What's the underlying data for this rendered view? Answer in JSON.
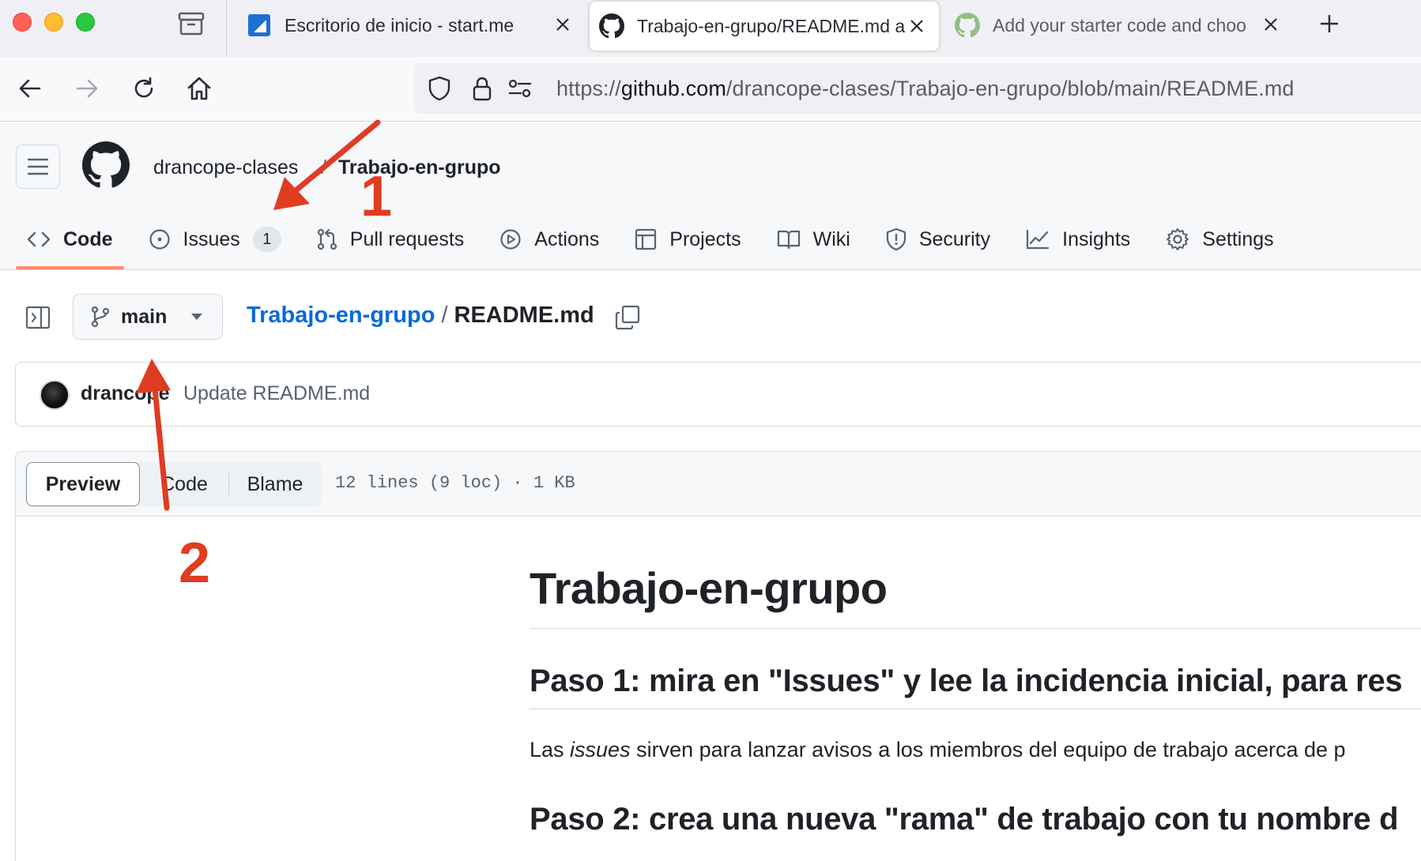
{
  "browser": {
    "tabs": [
      {
        "title": "Escritorio de inicio - start.me"
      },
      {
        "title": "Trabajo-en-grupo/README.md a"
      },
      {
        "title": "Add your starter code and choo"
      }
    ],
    "url": {
      "scheme": "https://",
      "host": "github.com",
      "path": "/drancope-clases/Trabajo-en-grupo/blob/main/README.md"
    }
  },
  "repo": {
    "owner": "drancope-clases",
    "separator": "/",
    "name": "Trabajo-en-grupo"
  },
  "nav": {
    "code": "Code",
    "issues": "Issues",
    "issues_count": "1",
    "pull_requests": "Pull requests",
    "actions": "Actions",
    "projects": "Projects",
    "wiki": "Wiki",
    "security": "Security",
    "insights": "Insights",
    "settings": "Settings"
  },
  "file": {
    "branch": "main",
    "repo_link": "Trabajo-en-grupo",
    "slash": "/",
    "filename": "README.md"
  },
  "commit": {
    "author": "drancope",
    "message": "Update README.md"
  },
  "viewer": {
    "preview": "Preview",
    "code": "Code",
    "blame": "Blame",
    "info": "12 lines (9 loc) · 1 KB"
  },
  "readme": {
    "h1": "Trabajo-en-grupo",
    "step1": "Paso 1: mira en \"Issues\" y lee la incidencia inicial, para res",
    "para_pre": "Las ",
    "para_em": "issues",
    "para_post": " sirven para lanzar avisos a los miembros del equipo de trabajo acerca de p",
    "step2": "Paso 2: crea una nueva \"rama\" de trabajo con tu nombre d"
  },
  "annotations": {
    "label_1": "1",
    "label_2": "2",
    "color": "#e03c22"
  },
  "colors": {
    "link": "#0969da",
    "tab_underline": "#fd8c73"
  }
}
